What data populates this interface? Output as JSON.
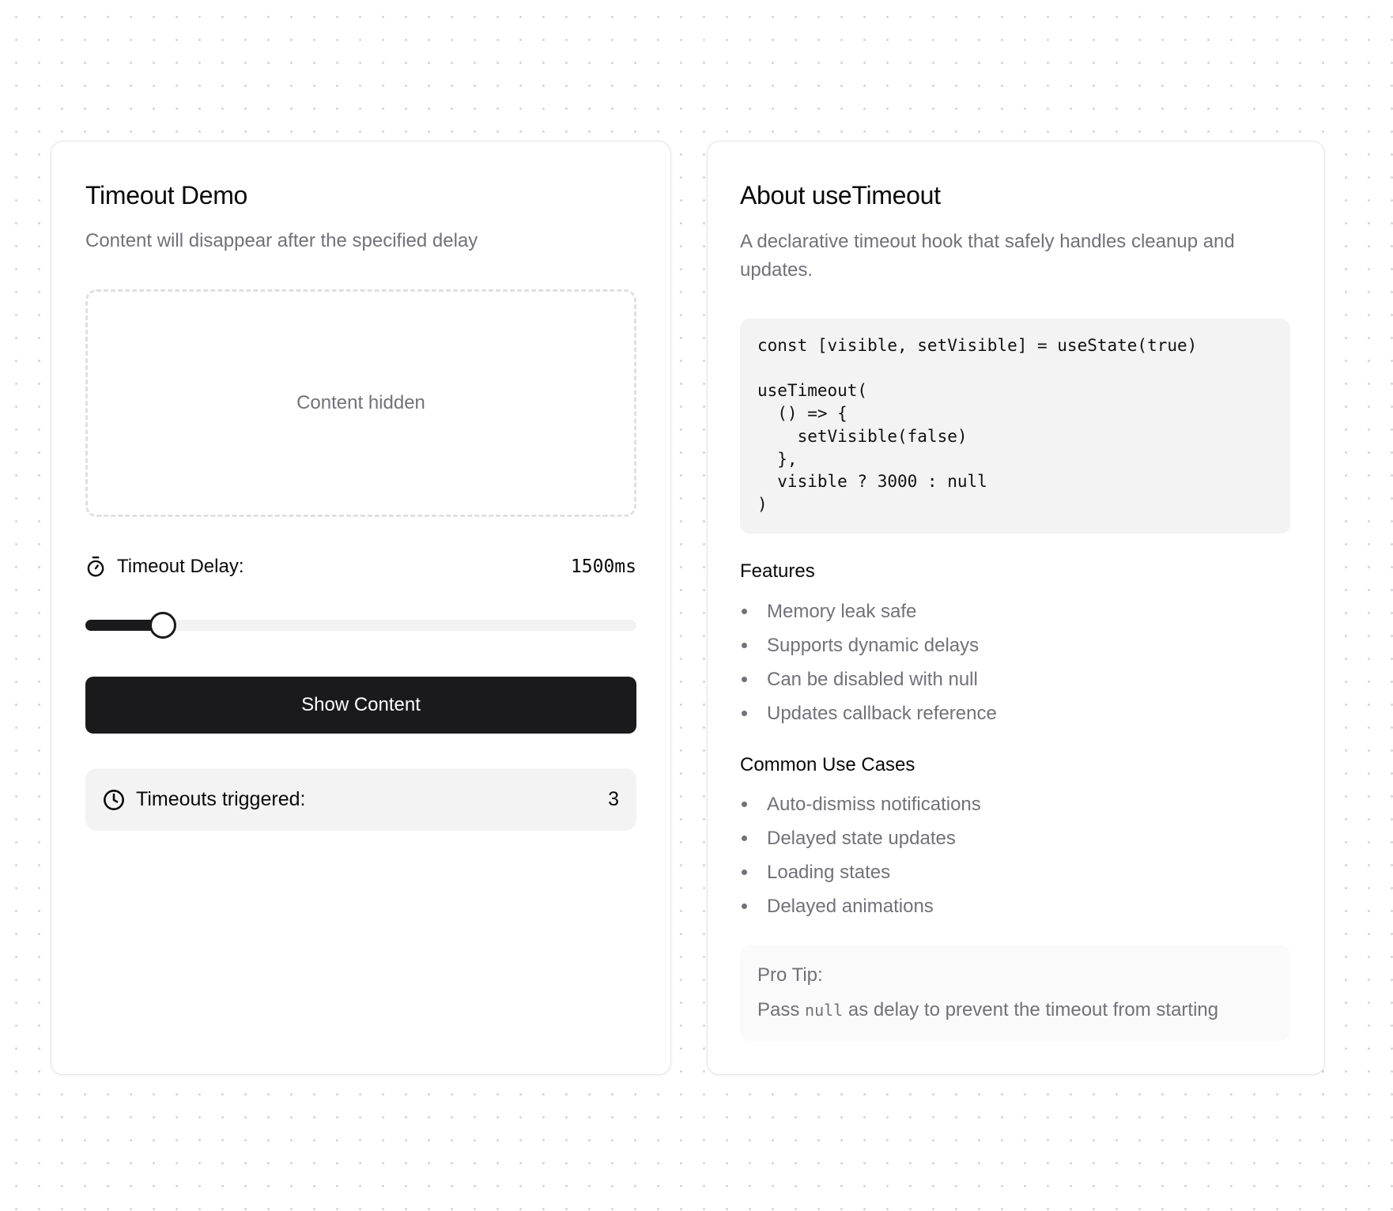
{
  "demo": {
    "title": "Timeout Demo",
    "subtitle": "Content will disappear after the specified delay",
    "content_placeholder": "Content hidden",
    "delay": {
      "icon": "timer-icon",
      "label": "Timeout Delay:",
      "value_text": "1500ms",
      "value_ms": 1500,
      "fill_fraction": 0.14
    },
    "show_button_label": "Show Content",
    "counter": {
      "icon": "clock-icon",
      "label": "Timeouts triggered:",
      "value": "3"
    }
  },
  "about": {
    "title": "About useTimeout",
    "description": "A declarative timeout hook that safely handles cleanup and updates.",
    "code": "const [visible, setVisible] = useState(true)\n\nuseTimeout(\n  () => {\n    setVisible(false)\n  },\n  visible ? 3000 : null\n)",
    "features": {
      "heading": "Features",
      "items": [
        "Memory leak safe",
        "Supports dynamic delays",
        "Can be disabled with null",
        "Updates callback reference"
      ]
    },
    "use_cases": {
      "heading": "Common Use Cases",
      "items": [
        "Auto-dismiss notifications",
        "Delayed state updates",
        "Loading states",
        "Delayed animations"
      ]
    },
    "pro_tip": {
      "title": "Pro Tip:",
      "body_before": "Pass ",
      "body_code": "null",
      "body_after": " as delay to prevent the timeout from starting"
    }
  },
  "colors": {
    "primary": "#1a1a1c",
    "muted_text": "#71717a",
    "surface_muted": "#f3f3f4",
    "border": "#e4e4e7"
  }
}
